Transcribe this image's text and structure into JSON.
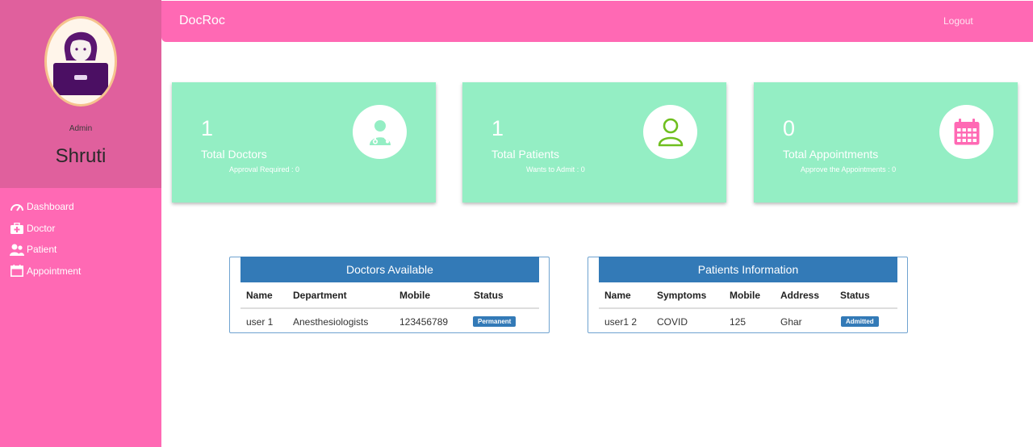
{
  "app": {
    "brand": "DocRoc",
    "logout_label": "Logout"
  },
  "profile": {
    "role": "Admin",
    "name": "Shruti"
  },
  "sidebar": {
    "items": [
      {
        "label": "Dashboard",
        "icon": "speedometer-icon"
      },
      {
        "label": "Doctor",
        "icon": "briefcase-medical-icon"
      },
      {
        "label": "Patient",
        "icon": "users-icon"
      },
      {
        "label": "Appointment",
        "icon": "calendar-icon"
      }
    ]
  },
  "stats": [
    {
      "value": "1",
      "label": "Total Doctors",
      "sub": "Approval Required : 0",
      "icon": "doctor-icon",
      "icon_color": "#94eec4"
    },
    {
      "value": "1",
      "label": "Total Patients",
      "sub": "Wants to Admit : 0",
      "icon": "user-icon",
      "icon_color": "#6fbf1f"
    },
    {
      "value": "0",
      "label": "Total Appointments",
      "sub": "Approve the Appointments : 0",
      "icon": "calendar-icon",
      "icon_color": "#ff69b4"
    }
  ],
  "doctors_table": {
    "title": "Doctors Available",
    "columns": [
      "Name",
      "Department",
      "Mobile",
      "Status"
    ],
    "rows": [
      {
        "name": "user 1",
        "department": "Anesthesiologists",
        "mobile": "123456789",
        "status": "Permanent"
      }
    ]
  },
  "patients_table": {
    "title": "Patients Information",
    "columns": [
      "Name",
      "Symptoms",
      "Mobile",
      "Address",
      "Status"
    ],
    "rows": [
      {
        "name": "user1 2",
        "symptoms": "COVID",
        "mobile": "125",
        "address": "Ghar",
        "status": "Admitted"
      }
    ]
  },
  "colors": {
    "sidebar": "#ff69b4",
    "profile_bg": "#e0609d",
    "card": "#94eec4",
    "table_head": "#337ab7"
  }
}
